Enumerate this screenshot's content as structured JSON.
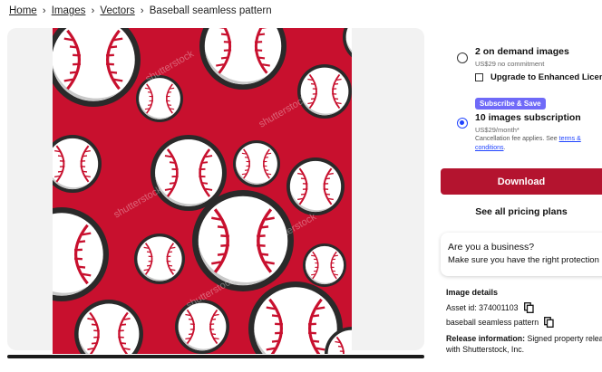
{
  "breadcrumb": {
    "items": [
      "Home",
      "Images",
      "Vectors"
    ],
    "current": "Baseball seamless pattern"
  },
  "preview": {
    "subject": "Baseball seamless pattern",
    "background_color": "#c8102e",
    "watermark_text": "shutterstock"
  },
  "plans": {
    "on_demand": {
      "title": "2 on demand images",
      "subtitle": "US$29 no commitment",
      "upgrade_label": "Upgrade to Enhanced License"
    },
    "subscription": {
      "badge": "Subscribe & Save",
      "title": "10 images subscription",
      "subtitle": "US$29/month*",
      "note_prefix": "Cancellation fee applies. See ",
      "note_link": "terms & conditions",
      "note_suffix": "."
    }
  },
  "actions": {
    "download_label": "Download",
    "pricing_label": "See all pricing plans"
  },
  "business": {
    "title": "Are you a business?",
    "subtitle": "Make sure you have the right protection"
  },
  "details": {
    "heading": "Image details",
    "asset_id_label": "Asset id: 374001103",
    "keyword": "baseball seamless pattern",
    "release_label": "Release information:",
    "release_text": " Signed property release",
    "release_line2": "with Shutterstock, Inc."
  },
  "colors": {
    "accent_red": "#b4142f",
    "badge_purple": "#6f6af8",
    "radio_blue": "#1f43ff"
  }
}
